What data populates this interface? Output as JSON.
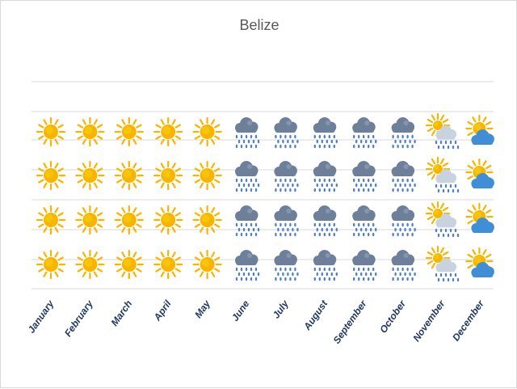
{
  "chart_data": {
    "type": "pictograph",
    "title": "Belize",
    "rows": 4,
    "categories": [
      "January",
      "February",
      "March",
      "April",
      "May",
      "June",
      "July",
      "August",
      "September",
      "October",
      "November",
      "December"
    ],
    "weather": [
      "sunny",
      "sunny",
      "sunny",
      "sunny",
      "sunny",
      "rainy",
      "rainy",
      "rainy",
      "rainy",
      "rainy",
      "sun-showers",
      "sun-clouds"
    ],
    "grid": true,
    "colors": {
      "sun": "#f7b500",
      "sun_core": "#f9c80e",
      "cloud_dark": "#6d7f99",
      "cloud_light": "#c9d3e0",
      "rain": "#4f7fc7",
      "blue_cloud": "#3f8ed6",
      "gridline": "#d9d9d9",
      "tick_label": "#1f3864"
    }
  }
}
